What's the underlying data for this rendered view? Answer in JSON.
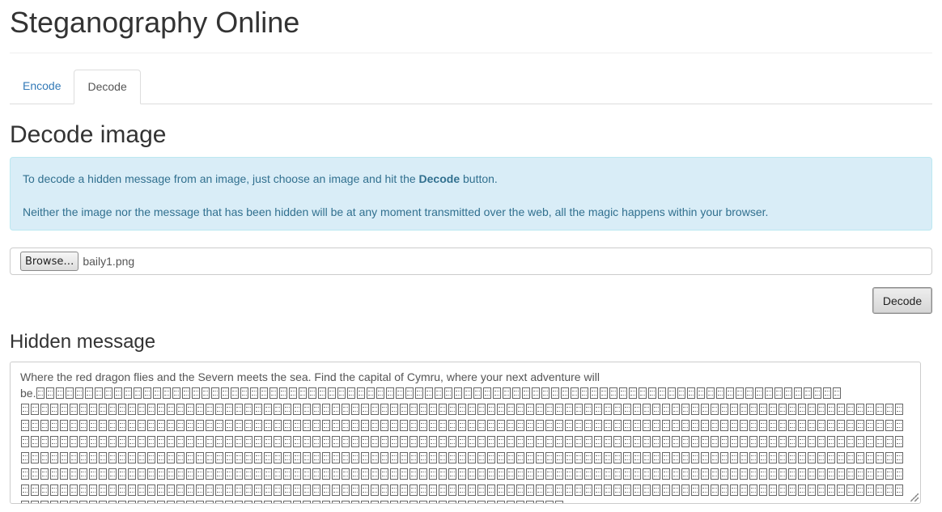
{
  "page": {
    "title": "Steganography Online"
  },
  "tabs": [
    {
      "label": "Encode",
      "active": false
    },
    {
      "label": "Decode",
      "active": true
    }
  ],
  "decode": {
    "heading": "Decode image",
    "info_line1_prefix": "To decode a hidden message from an image, just choose an image and hit the ",
    "info_line1_bold": "Decode",
    "info_line1_suffix": " button.",
    "info_line2": "Neither the image nor the message that has been hidden will be at any moment transmitted over the web, all the magic happens within your browser.",
    "browse_label": "Browse…",
    "file_name": "baily1.png",
    "decode_button": "Decode"
  },
  "hidden_message": {
    "heading": "Hidden message",
    "line1": "Where the red dragon flies and the Severn meets the sea. Find the capital of Cymru, where your next adventure will",
    "line2_prefix": "be."
  },
  "colors": {
    "link": "#337ab7",
    "alert_bg": "#d9edf7",
    "alert_text": "#31708f"
  }
}
